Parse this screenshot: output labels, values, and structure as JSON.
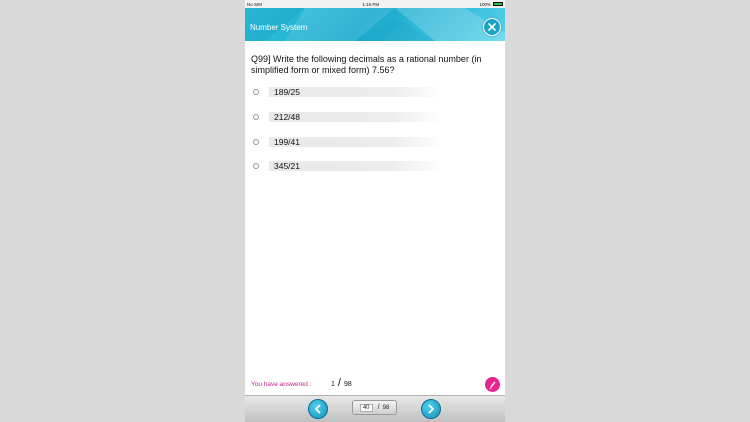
{
  "status_bar": {
    "carrier": "No SIM",
    "time": "1:16 PM",
    "battery": "100%"
  },
  "header": {
    "title": "Number System"
  },
  "question": {
    "text": "Q99]    Write the following decimals as a rational number (in simplified form or mixed form) 7.56?"
  },
  "options": [
    {
      "label": "189/25"
    },
    {
      "label": "212/48"
    },
    {
      "label": "199/41"
    },
    {
      "label": "345/21"
    }
  ],
  "progress": {
    "label": "You have answered :",
    "answered": "1",
    "total": "98"
  },
  "navigation": {
    "current_page": "40",
    "total_pages": "98",
    "separator": "/"
  },
  "colors": {
    "header": "#1fb2d4",
    "progress_label": "#c0238f",
    "edit_button": "#e8248e"
  },
  "icons": {
    "close": "close-icon",
    "edit": "pen-icon",
    "prev": "chevron-left-icon",
    "next": "chevron-right-icon"
  }
}
